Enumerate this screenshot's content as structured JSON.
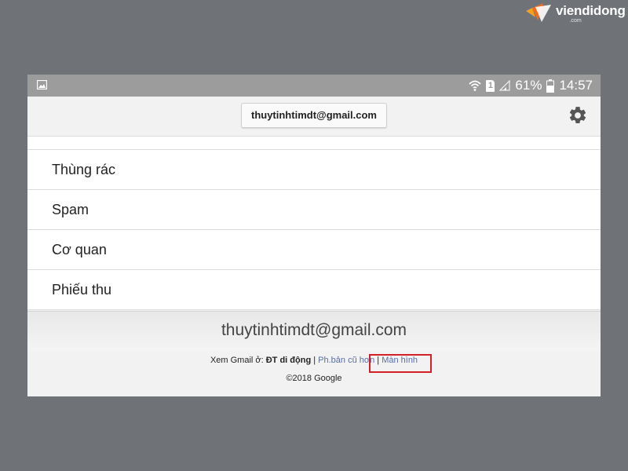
{
  "watermark": {
    "brand": "viendidong",
    "sub": ".com"
  },
  "status_bar": {
    "battery": "61%",
    "time": "14:57",
    "sim_slot": "1"
  },
  "app_bar": {
    "account": "thuytinhtimdt@gmail.com"
  },
  "labels": [
    {
      "label": "Thùng rác"
    },
    {
      "label": "Spam"
    },
    {
      "label": "Cơ quan"
    },
    {
      "label": "Phiếu thu"
    }
  ],
  "footer": {
    "account_email": "thuytinhtimdt@gmail.com",
    "view_prefix": "Xem Gmail ở:",
    "mobile": "ĐT di động",
    "separator": "|",
    "older_version": "Ph.bản cũ hơn",
    "desktop": "Màn hình",
    "copyright": "©2018 Google"
  },
  "colors": {
    "highlight": "#d42128",
    "link": "#5a6ea0",
    "status_bar": "#9c9c9c",
    "background": "#6f7276"
  }
}
